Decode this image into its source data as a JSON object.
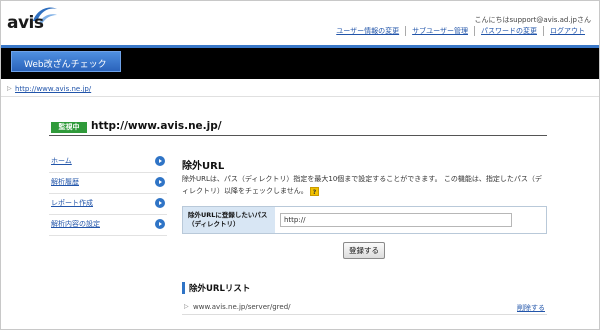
{
  "brand": {
    "logo_text": "avis",
    "accent": "#3a78c8",
    "swoosh_color": "#2f6fbf"
  },
  "header": {
    "greeting": "こんにちはsupport@avis.ad.jpさん",
    "nav": [
      {
        "label": "ユーザー情報の変更"
      },
      {
        "label": "サブユーザー管理"
      },
      {
        "label": "パスワードの変更"
      },
      {
        "label": "ログアウト"
      }
    ]
  },
  "app_tab": {
    "label": "Web改ざんチェック"
  },
  "breadcrumb": {
    "link": "http://www.avis.ne.jp/"
  },
  "site": {
    "status_badge": "監視中",
    "status_color": "#2f9a3a",
    "url": "http://www.avis.ne.jp/"
  },
  "sidebar": {
    "items": [
      {
        "label": "ホーム"
      },
      {
        "label": "解析履歴"
      },
      {
        "label": "レポート作成"
      },
      {
        "label": "解析内容の設定"
      }
    ]
  },
  "main": {
    "section_title": "除外URL",
    "description": "除外URLは、パス（ディレクトリ）指定を最大10個まで設定することができます。 この機能は、指定したパス（ディレクトリ）以降をチェックしません。",
    "help_icon_text": "?",
    "form": {
      "label_line1": "除外URLに登録したいパス",
      "label_line2": "（ディレクトリ）",
      "input_value": "http://"
    },
    "register_button": "登録する",
    "list_title": "除外URLリスト",
    "list": [
      {
        "url": "www.avis.ne.jp/server/gred/",
        "action": "削除する"
      }
    ]
  }
}
